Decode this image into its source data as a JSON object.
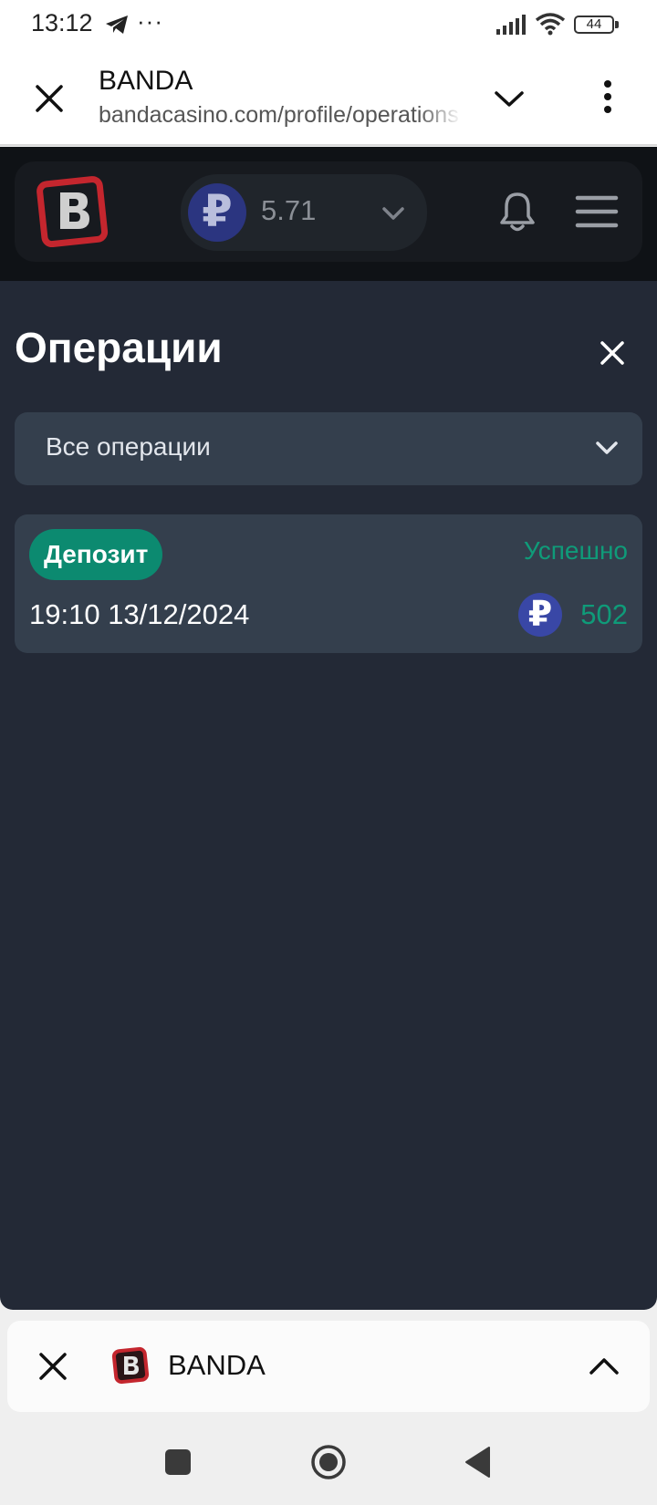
{
  "status_bar": {
    "time": "13:12",
    "overflow": "···",
    "battery": "44",
    "icons": [
      "telegram-icon",
      "signal-icon",
      "wifi-icon",
      "battery-icon"
    ]
  },
  "browser": {
    "title": "BANDA",
    "url": "bandacasino.com/profile/operations",
    "icons": [
      "close-icon",
      "chevron-down-icon",
      "more-vert-icon"
    ]
  },
  "header": {
    "balance": "5.71",
    "currency_symbol": "₽",
    "icons": [
      "logo",
      "bell-icon",
      "hamburger-menu-icon"
    ]
  },
  "operations": {
    "title": "Операции",
    "filter": {
      "selected": "Все операции"
    },
    "items": [
      {
        "type": "Депозит",
        "status": "Успешно",
        "datetime": "19:10 13/12/2024",
        "currency_symbol": "₽",
        "amount": "502"
      }
    ]
  },
  "tab_sheet": {
    "title": "BANDA"
  },
  "colors": {
    "panel_bg": "#232936",
    "card_bg": "#343f4d",
    "accent_green": "#0f9b79",
    "badge_green": "#0c8a70",
    "rub_blue": "#3947a6",
    "logo_red": "#c4262e"
  }
}
